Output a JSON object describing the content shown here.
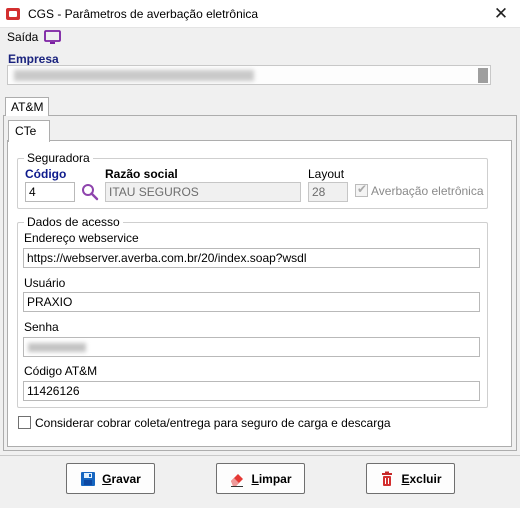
{
  "window": {
    "title": "CGS - Parâmetros de averbação eletrônica",
    "close_glyph": "✕"
  },
  "menu": {
    "exit_label": "Saída",
    "exit_icon": "monitor-icon",
    "icon_color": "#7b1fa2"
  },
  "company": {
    "label": "Empresa"
  },
  "tabs": {
    "outer": "AT&M",
    "inner": "CTe"
  },
  "insurer": {
    "group_label": "Seguradora",
    "code_label": "Código",
    "code_value": "4",
    "name_label": "Razão social",
    "name_value": "ITAU SEGUROS",
    "layout_label": "Layout",
    "layout_value": "28",
    "electronic_label": "Averbação eletrônica",
    "electronic_checked": true
  },
  "access": {
    "group_label": "Dados de acesso",
    "webservice_label": "Endereço webservice",
    "webservice_value": "https://webserver.averba.com.br/20/index.soap?wsdl",
    "user_label": "Usuário",
    "user_value": "PRAXIO",
    "password_label": "Senha",
    "atm_code_label": "Código AT&M",
    "atm_code_value": "11426126"
  },
  "options": {
    "charge_collection_label": "Considerar cobrar coleta/entrega para seguro de carga e descarga",
    "charge_collection_checked": false
  },
  "buttons": {
    "save_first": "G",
    "save_rest": "ravar",
    "clear_first": "L",
    "clear_rest": "impar",
    "delete_first": "E",
    "delete_rest": "xcluir"
  },
  "colors": {
    "accent_blue": "#0d1a8c",
    "delete_red": "#d32f2f",
    "search_purple": "#8e44ad"
  }
}
